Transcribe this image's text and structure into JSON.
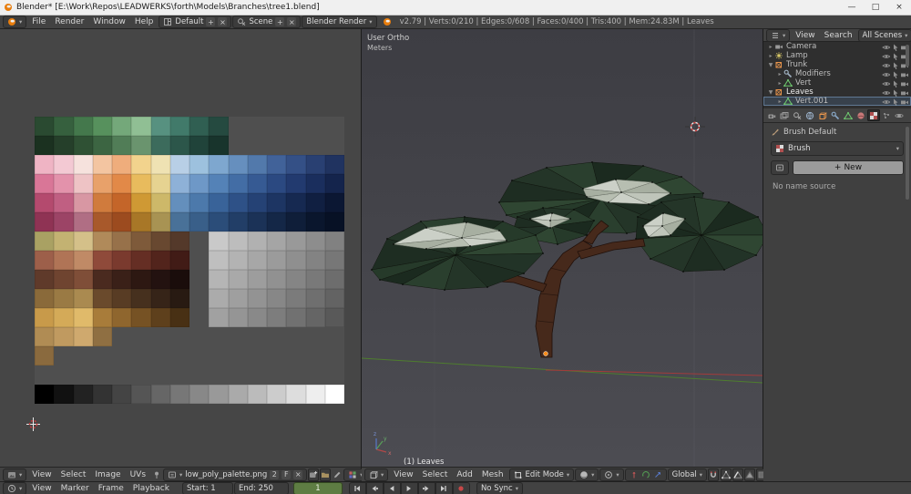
{
  "titlebar": {
    "title": "Blender* [E:\\Work\\Repos\\LEADWERKS\\forth\\Models\\Branches\\tree1.blend]",
    "min": "—",
    "max": "□",
    "close": "×"
  },
  "infobar": {
    "menus": [
      "File",
      "Render",
      "Window",
      "Help"
    ],
    "layout": "Default",
    "scene": "Scene",
    "engine": "Blender Render",
    "stats": "v2.79 | Verts:0/210 | Edges:0/608 | Faces:0/400 | Tris:400 | Mem:24.83M | Leaves"
  },
  "uv_editor": {
    "menus": [
      "View",
      "Select",
      "Image",
      "UVs"
    ],
    "image_name": "low_poly_palette.png",
    "users_count": "2",
    "fake_user": "F",
    "unlink": "×",
    "palette_rows": [
      [
        "#2a4a31",
        "#36603e",
        "#44784c",
        "#57915d",
        "#74a87a",
        "#90bf94",
        "#579180",
        "#417a6a",
        "#305f52",
        "#254a40",
        null,
        null,
        null,
        null,
        null,
        null
      ],
      [
        "#1b3120",
        "#253f2a",
        "#2f5134",
        "#3c6542",
        "#517d57",
        "#6a946e",
        "#3c6b5c",
        "#2c564a",
        "#20433a",
        "#18342c",
        null,
        null,
        null,
        null,
        null,
        null
      ],
      [
        "#efb4c4",
        "#f3c9d3",
        "#f6e2dd",
        "#f3c5a1",
        "#efad7c",
        "#f2d38d",
        "#efe2b3",
        "#b8cfe6",
        "#9dc1de",
        "#7ea7cf",
        "#668fbe",
        "#5279ab",
        "#416299",
        "#345086",
        "#294072",
        "#203360"
      ],
      [
        "#d97697",
        "#e392ab",
        "#eec3c5",
        "#e8a16a",
        "#e28948",
        "#e8bb5d",
        "#e6d391",
        "#8eb1d7",
        "#6e98c7",
        "#5482b7",
        "#436da5",
        "#365a93",
        "#2b4981",
        "#223a6f",
        "#1a2e5d",
        "#14244c"
      ],
      [
        "#b44a6e",
        "#c05f82",
        "#d897a3",
        "#d07b3d",
        "#c46529",
        "#cf9934",
        "#cdb869",
        "#648fbc",
        "#4c79ab",
        "#396399",
        "#2e5187",
        "#254275",
        "#1d3563",
        "#162951",
        "#101f41",
        "#0b1733"
      ],
      [
        "#8f3354",
        "#9c4466",
        "#b06e84",
        "#a8592b",
        "#9c4b1f",
        "#a87727",
        "#a89353",
        "#497198",
        "#395f89",
        "#2b4d79",
        "#223e67",
        "#1b3257",
        "#142747",
        "#0f1e39",
        "#0a162d",
        "#071125"
      ],
      [
        "#a9a163",
        "#c3b272",
        "#d4c089",
        "#b08a5a",
        "#97714a",
        "#7e5a3a",
        "#684830",
        "#54392a",
        null,
        "#c9c9c9",
        "#bdbdbd",
        "#b1b1b1",
        "#a5a5a5",
        "#999999",
        "#8d8d8d",
        "#818181"
      ],
      [
        "#9d5f4a",
        "#b07456",
        "#c08a66",
        "#8f4a3a",
        "#7a3a2e",
        "#652e24",
        "#52241c",
        "#411b16",
        null,
        "#bfbfbf",
        "#b3b3b3",
        "#a7a7a7",
        "#9b9b9b",
        "#8f8f8f",
        "#838383",
        "#777777"
      ],
      [
        "#5f3a2a",
        "#6f4430",
        "#7f4e38",
        "#4a2a1f",
        "#3a2018",
        "#2d1812",
        "#231210",
        "#1a0d0b",
        null,
        "#b5b5b5",
        "#a9a9a9",
        "#9d9d9d",
        "#919191",
        "#858585",
        "#797979",
        "#6d6d6d"
      ],
      [
        "#8a6a3a",
        "#9a7a44",
        "#aa8a50",
        "#6a4a2c",
        "#583c24",
        "#46301e",
        "#362418",
        "#281a12",
        null,
        "#ababab",
        "#9f9f9f",
        "#939393",
        "#878787",
        "#7b7b7b",
        "#6f6f6f",
        "#636363"
      ],
      [
        "#c89a4a",
        "#d4aa58",
        "#e0ba6a",
        "#a87c3a",
        "#8f662e",
        "#765224",
        "#5e401c",
        "#483014",
        null,
        "#a1a1a1",
        "#959595",
        "#898989",
        "#7d7d7d",
        "#717171",
        "#656565",
        "#595959"
      ],
      [
        "#b08c54",
        "#c09a60",
        "#cfa96e",
        "#8f6f42",
        null,
        null,
        null,
        null,
        null,
        null,
        null,
        null,
        null,
        null,
        null,
        null
      ],
      [
        "#8a6a3e",
        null,
        null,
        null,
        null,
        null,
        null,
        null,
        null,
        null,
        null,
        null,
        null,
        null,
        null,
        null
      ],
      [
        null,
        null,
        null,
        null,
        null,
        null,
        null,
        null,
        null,
        null,
        null,
        null,
        null,
        null,
        null,
        null
      ],
      [
        "#000000",
        "#111111",
        "#222222",
        "#333333",
        "#444444",
        "#555555",
        "#666666",
        "#777777",
        "#888888",
        "#999999",
        "#aaaaaa",
        "#bbbbbb",
        "#cccccc",
        "#dddddd",
        "#eeeeee",
        "#ffffff"
      ]
    ]
  },
  "viewport3d": {
    "view_label": "User Ortho",
    "unit_label": "Meters",
    "status_label": "(1) Leaves",
    "menus": [
      "View",
      "Select",
      "Add",
      "Mesh"
    ],
    "mode": "Edit Mode",
    "orientation": "Global",
    "axis_labels": [
      "x",
      "y",
      "z"
    ]
  },
  "outliner": {
    "menus": [
      "View",
      "Search"
    ],
    "display_filter": "All Scenes",
    "items": [
      {
        "label": "Camera",
        "icon": "camera-object-icon",
        "depth": 0,
        "arrow": "right"
      },
      {
        "label": "Lamp",
        "icon": "lamp-icon",
        "depth": 0,
        "arrow": "right"
      },
      {
        "label": "Trunk",
        "icon": "mesh-object-icon",
        "depth": 0,
        "arrow": "down"
      },
      {
        "label": "Modifiers",
        "icon": "wrench-icon",
        "depth": 1,
        "arrow": "right"
      },
      {
        "label": "Vert",
        "icon": "mesh-data-icon",
        "depth": 1,
        "arrow": "right"
      },
      {
        "label": "Leaves",
        "icon": "mesh-object-icon",
        "depth": 0,
        "arrow": "down",
        "active": true
      },
      {
        "label": "Vert.001",
        "icon": "mesh-data-icon",
        "depth": 1,
        "arrow": "right",
        "selected": true
      }
    ]
  },
  "properties": {
    "tabs": [
      {
        "icon": "render-icon"
      },
      {
        "icon": "render-layers-icon"
      },
      {
        "icon": "scene-icon"
      },
      {
        "icon": "world-icon"
      },
      {
        "icon": "object-icon"
      },
      {
        "icon": "modifiers-icon"
      },
      {
        "icon": "object-data-icon"
      },
      {
        "icon": "material-icon"
      },
      {
        "icon": "texture-icon",
        "active": true
      },
      {
        "icon": "particles-icon"
      },
      {
        "icon": "physics-icon"
      }
    ],
    "breadcrumb": "Brush Default",
    "context_label": "Brush",
    "new_button": "New",
    "empty_note": "No name source"
  },
  "timeline": {
    "menus": [
      "View",
      "Marker",
      "Frame",
      "Playback"
    ],
    "start_field": "Start: 1",
    "end_field": "End: 250",
    "frame_field": "1",
    "sync_mode": "No Sync",
    "buttons": [
      "jump-start-icon",
      "prev-keyframe-icon",
      "play-reverse-icon",
      "play-icon",
      "next-keyframe-icon",
      "jump-end-icon",
      "record-icon"
    ]
  },
  "scene_colors": {
    "canopy": [
      "#1e2d22",
      "#243528",
      "#2a3f2e",
      "#1b2a1f",
      "#263a2a",
      "#2f4632",
      "#223327"
    ],
    "canopy_light": [
      "#cbd0c7",
      "#b7beb1",
      "#a7afa1",
      "#bfc5ba"
    ],
    "trunk": "#46291b",
    "trunk_edge": "#20100a",
    "origin": "#ff8c19",
    "axis_x": "#a23b3b",
    "axis_y": "#4e7d2e",
    "cursor_red": "#cc3a3a"
  }
}
